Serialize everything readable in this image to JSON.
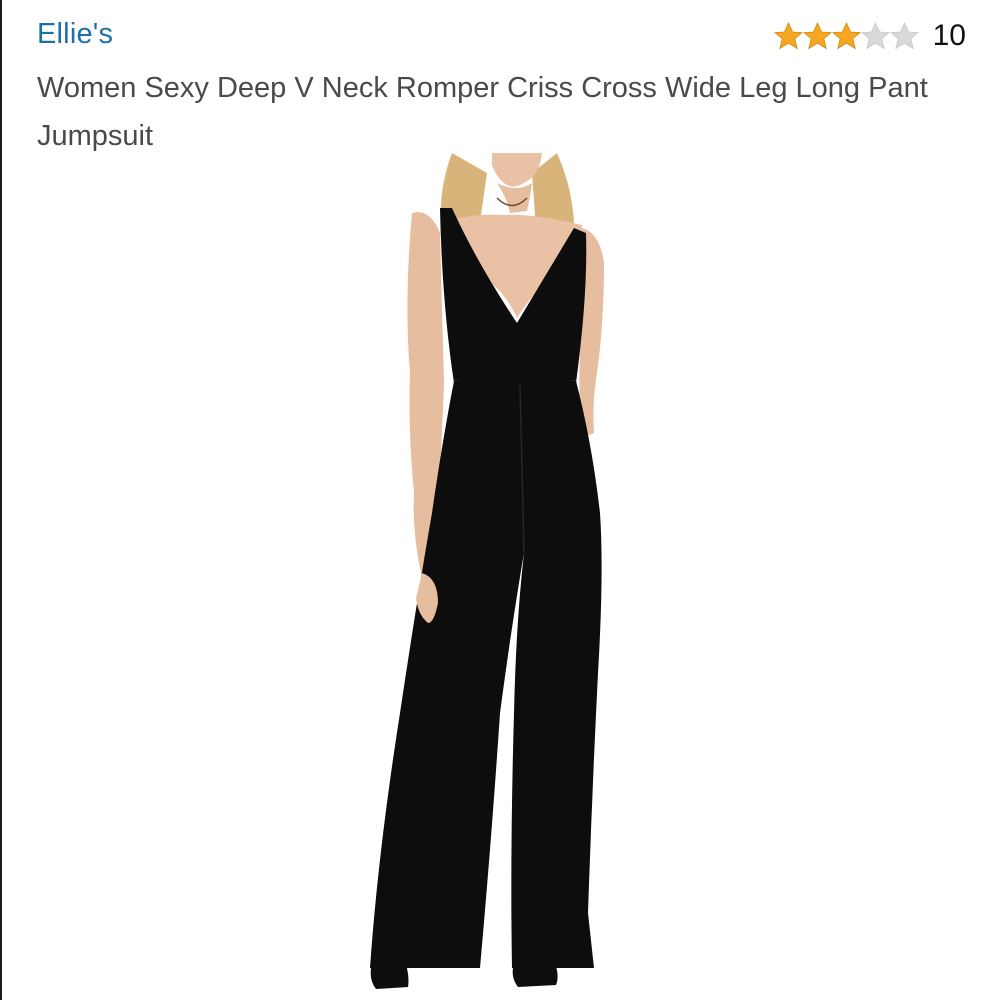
{
  "listing": {
    "brand": "Ellie's",
    "title": "Women Sexy Deep V Neck Romper Criss Cross Wide Leg Long Pant Jumpsuit",
    "rating": {
      "stars": 3,
      "max_stars": 5,
      "review_count": "10",
      "filled_color": "#f5a623",
      "empty_color": "#d9d9d9"
    },
    "image": {
      "icon": "product-photo-black-jumpsuit"
    }
  },
  "colors": {
    "brand_link": "#1f6fa8",
    "title_text": "#4a4a4a",
    "garment": "#0d0d0d",
    "skin": "#e9c2a6",
    "hair": "#d8b47a"
  }
}
